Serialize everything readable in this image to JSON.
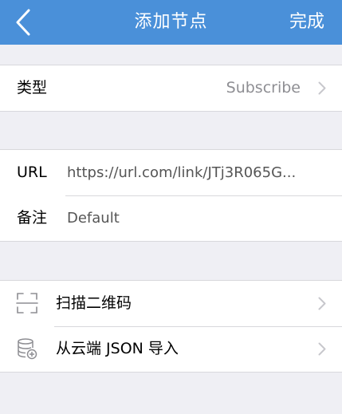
{
  "navbar": {
    "title": "添加节点",
    "done_label": "完成",
    "back_icon": "chevron-left-icon"
  },
  "type_section": {
    "label": "类型",
    "value": "Subscribe"
  },
  "detail_section": {
    "url_label": "URL",
    "url_value": "https://url.com/link/JTj3R065G...",
    "remark_label": "备注",
    "remark_value": "Default"
  },
  "import_section": {
    "items": [
      {
        "label": "扫描二维码",
        "icon": "qr-scan-icon"
      },
      {
        "label": "从云端 JSON 导入",
        "icon": "cloud-database-icon"
      }
    ]
  },
  "colors": {
    "accent": "#4a90d9",
    "background": "#efeff4",
    "secondary_text": "#8e8e93"
  }
}
